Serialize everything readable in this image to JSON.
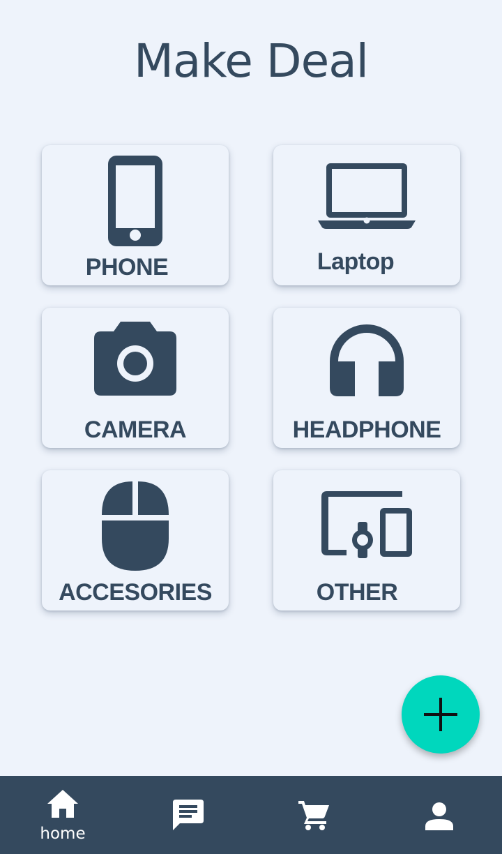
{
  "app": {
    "title": "Make Deal"
  },
  "categories": [
    {
      "label": "PHONE",
      "icon": "phone-icon"
    },
    {
      "label": "Laptop",
      "icon": "laptop-icon"
    },
    {
      "label": "CAMERA",
      "icon": "camera-icon"
    },
    {
      "label": "HEADPHONE",
      "icon": "headphone-icon"
    },
    {
      "label": "ACCESORIES",
      "icon": "mouse-icon"
    },
    {
      "label": "OTHER",
      "icon": "devices-icon"
    }
  ],
  "fab": {
    "icon": "plus-icon"
  },
  "bottom_nav": {
    "items": [
      {
        "label": "home",
        "icon": "home-icon"
      },
      {
        "label": "",
        "icon": "chat-icon"
      },
      {
        "label": "",
        "icon": "cart-icon"
      },
      {
        "label": "",
        "icon": "person-icon"
      }
    ]
  },
  "colors": {
    "background": "#eef3fb",
    "primary_dark": "#34495e",
    "accent": "#00d7bd"
  }
}
